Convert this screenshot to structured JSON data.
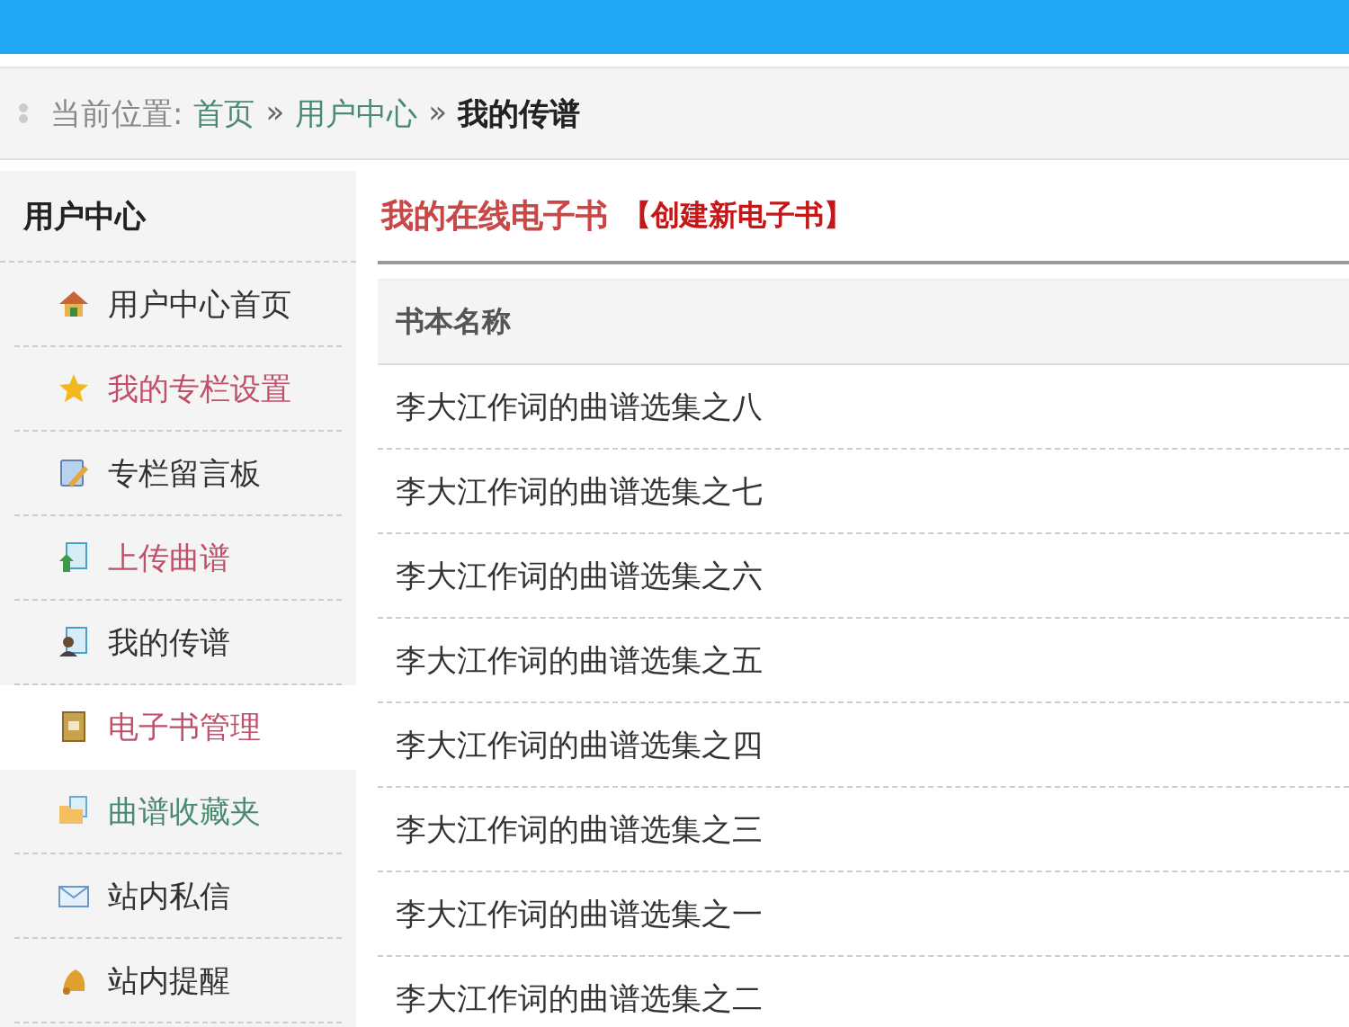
{
  "breadcrumb": {
    "label": "当前位置:",
    "links": [
      "首页",
      "用户中心"
    ],
    "separators": [
      "»",
      "»"
    ],
    "current": "我的传谱"
  },
  "sidebar": {
    "title": "用户中心",
    "items": [
      {
        "label": "用户中心首页",
        "kind": "home",
        "color": "#333333",
        "selected": false
      },
      {
        "label": "我的专栏设置",
        "kind": "star",
        "color": "#c0506a",
        "selected": false
      },
      {
        "label": "专栏留言板",
        "kind": "board",
        "color": "#333333",
        "selected": false
      },
      {
        "label": "上传曲谱",
        "kind": "upload",
        "color": "#c0506a",
        "selected": false
      },
      {
        "label": "我的传谱",
        "kind": "person",
        "color": "#333333",
        "selected": false
      },
      {
        "label": "电子书管理",
        "kind": "book",
        "color": "#c0506a",
        "selected": true
      },
      {
        "label": "曲谱收藏夹",
        "kind": "folder",
        "color": "#4a8a70",
        "selected": false
      },
      {
        "label": "站内私信",
        "kind": "mail",
        "color": "#333333",
        "selected": false
      },
      {
        "label": "站内提醒",
        "kind": "bell",
        "color": "#333333",
        "selected": false
      }
    ]
  },
  "main": {
    "title": "我的在线电子书",
    "create_link": "【创建新电子书】",
    "table": {
      "columns": [
        "书本名称"
      ],
      "rows": [
        "李大江作词的曲谱选集之八",
        "李大江作词的曲谱选集之七",
        "李大江作词的曲谱选集之六",
        "李大江作词的曲谱选集之五",
        "李大江作词的曲谱选集之四",
        "李大江作词的曲谱选集之三",
        "李大江作词的曲谱选集之一",
        "李大江作词的曲谱选集之二"
      ]
    }
  }
}
